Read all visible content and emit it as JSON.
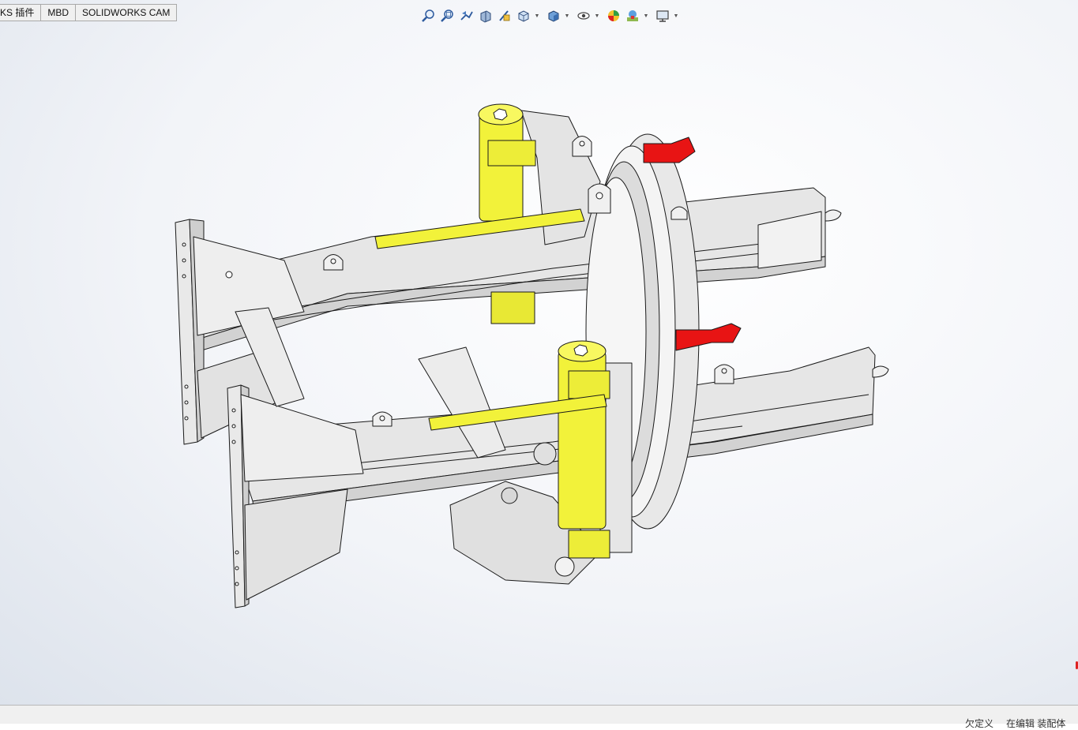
{
  "command_manager": {
    "tabs": [
      {
        "label": "KS 插件"
      },
      {
        "label": "MBD"
      },
      {
        "label": "SOLIDWORKS CAM"
      }
    ]
  },
  "heads_up_toolbar": {
    "icons": [
      "zoom-to-fit-icon",
      "zoom-to-area-icon",
      "previous-view-icon",
      "section-view-icon",
      "dynamic-annotation-icon",
      "view-orientation-icon",
      "display-style-icon",
      "hide-show-items-icon",
      "edit-appearance-icon",
      "apply-scene-icon",
      "view-settings-icon"
    ]
  },
  "status_bar": {
    "text_1": "欠定义",
    "text_2": "在编辑 装配体"
  },
  "colors": {
    "cylinder_yellow": "#f2f23a",
    "connector_red": "#e81414",
    "frame_gray": "#e6e6e6",
    "edge_black": "#1a1a1a"
  }
}
